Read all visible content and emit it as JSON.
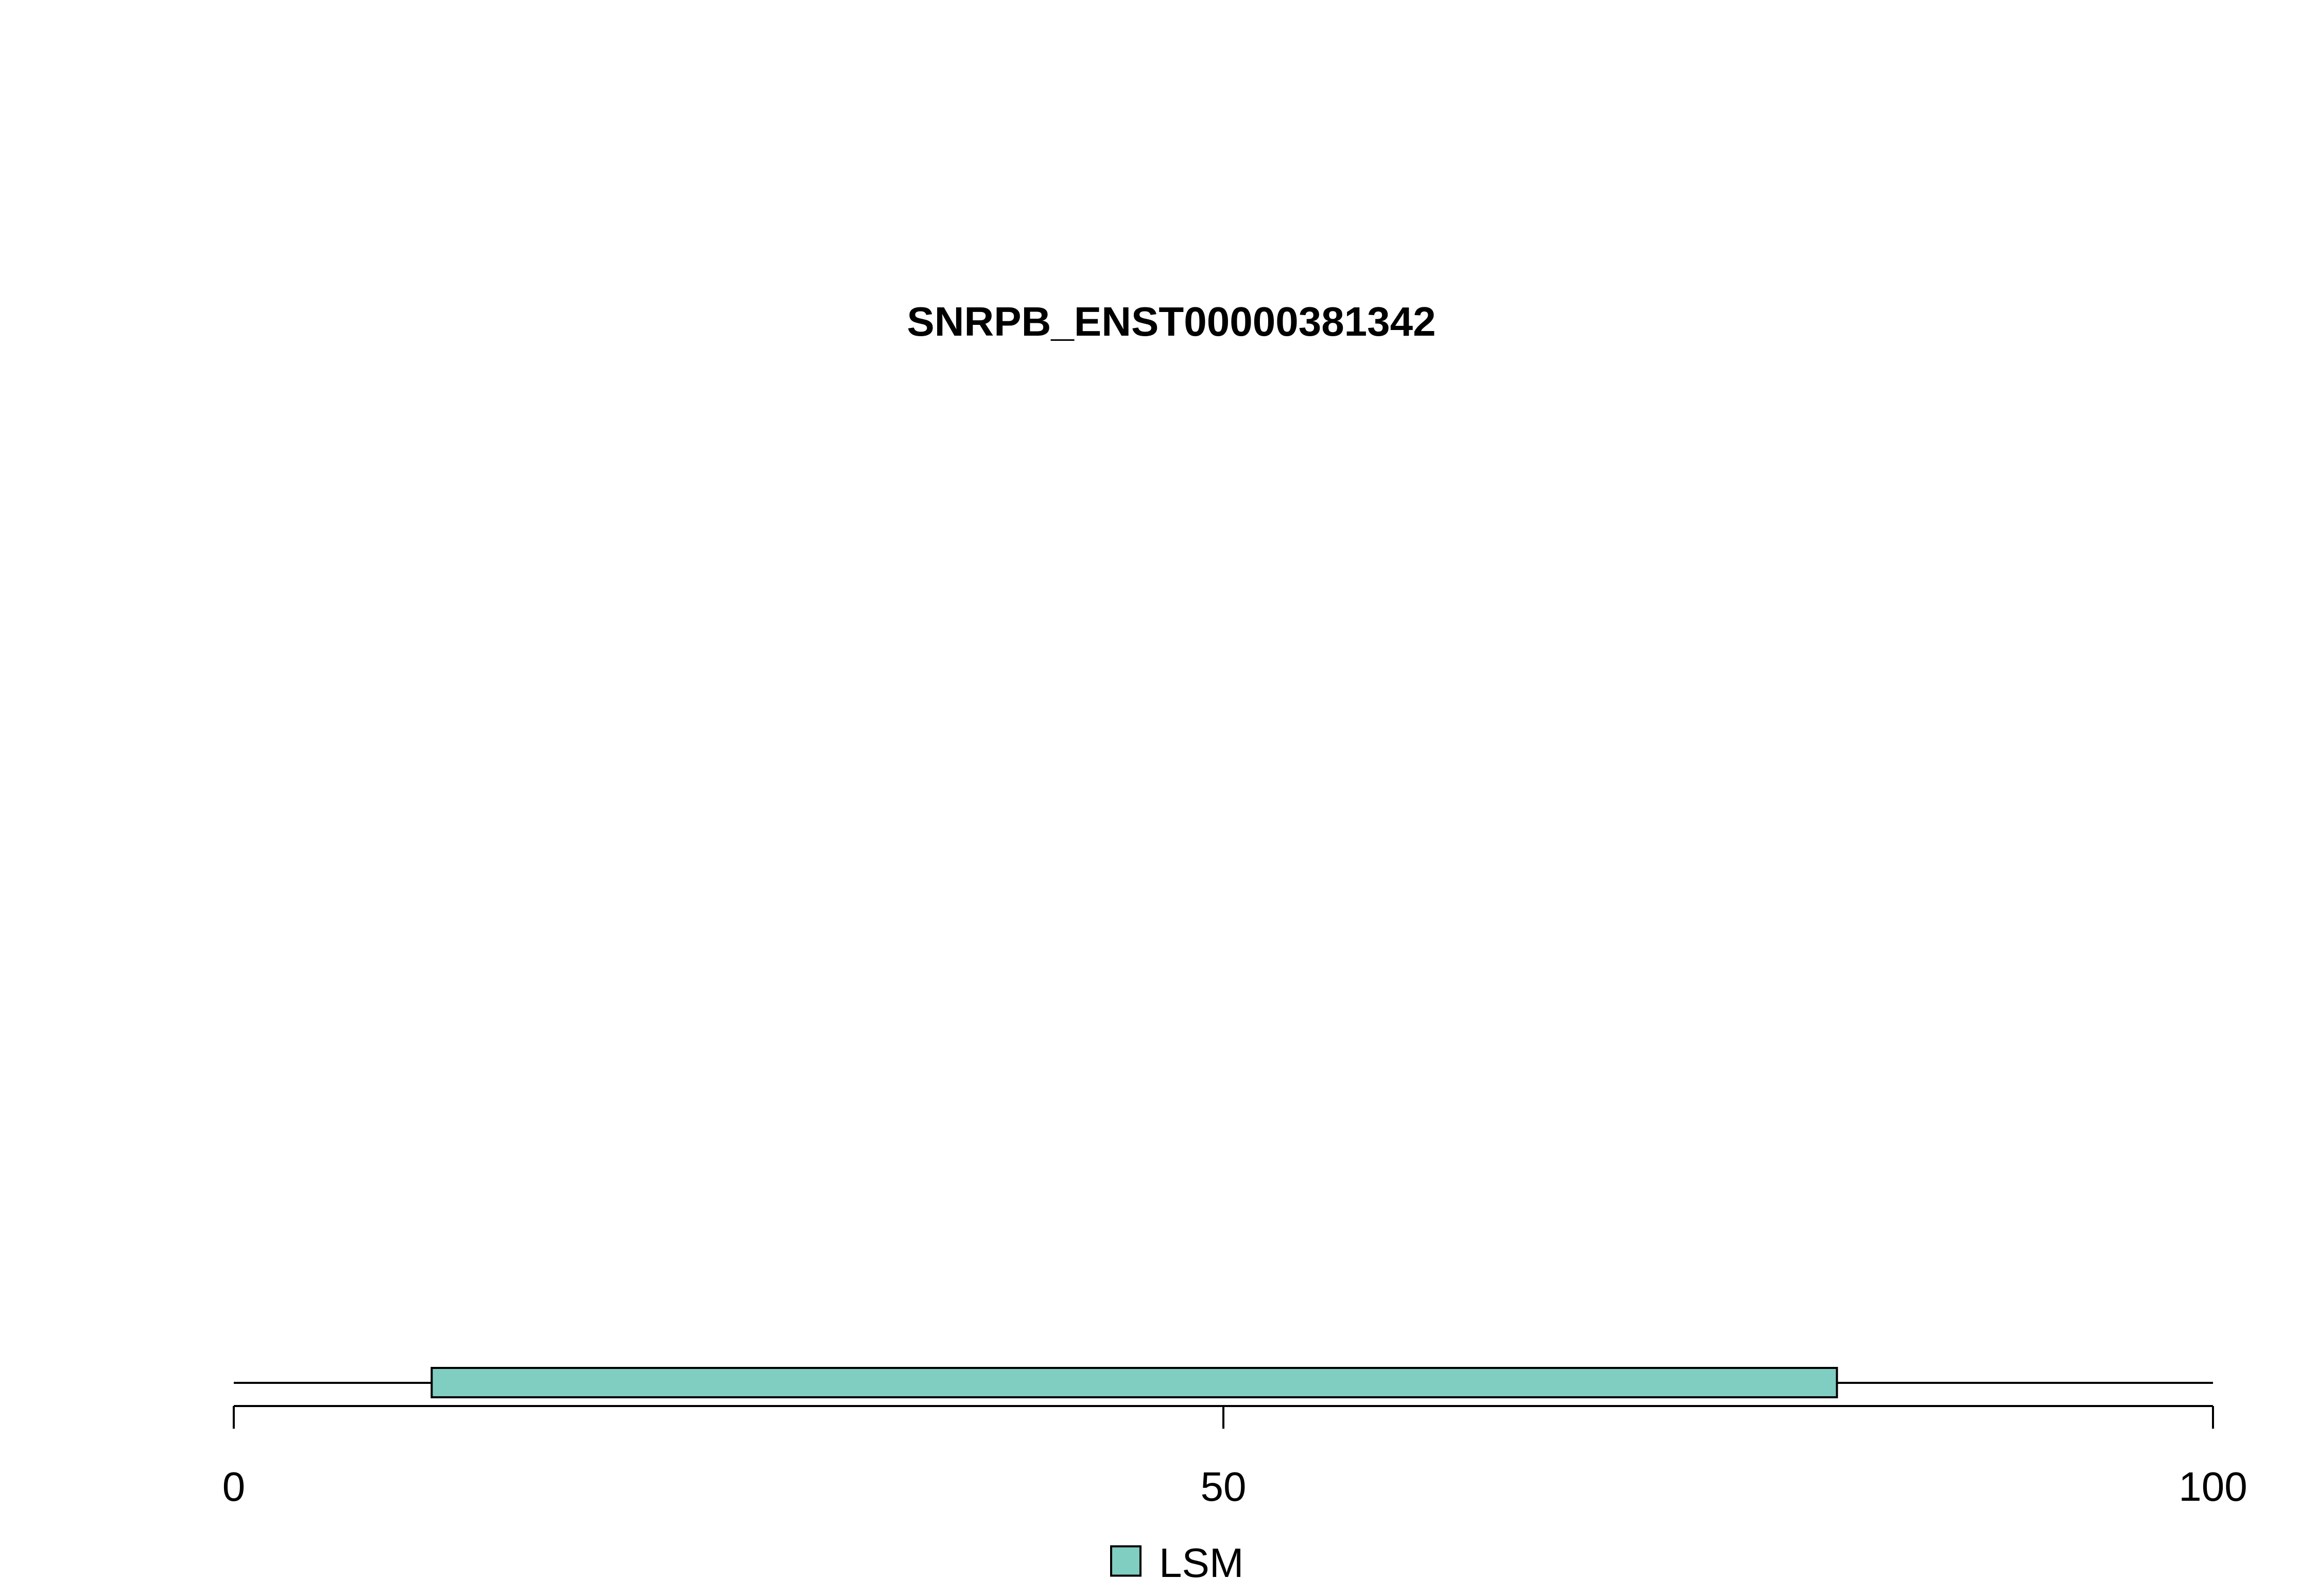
{
  "chart_data": {
    "type": "domain-track",
    "title": "SNRPB_ENST00000381342",
    "protein_length": 100,
    "x_range": [
      0,
      100
    ],
    "x_ticks": [
      0,
      50,
      100
    ],
    "x_tick_labels": [
      "0",
      "50",
      "100"
    ],
    "domains": [
      {
        "name": "LSM",
        "start": 10,
        "end": 81,
        "color": "#80CDC1"
      }
    ],
    "legend": [
      {
        "label": "LSM",
        "color": "#80CDC1"
      }
    ],
    "legend_position": "bottom-center",
    "grid": false
  }
}
